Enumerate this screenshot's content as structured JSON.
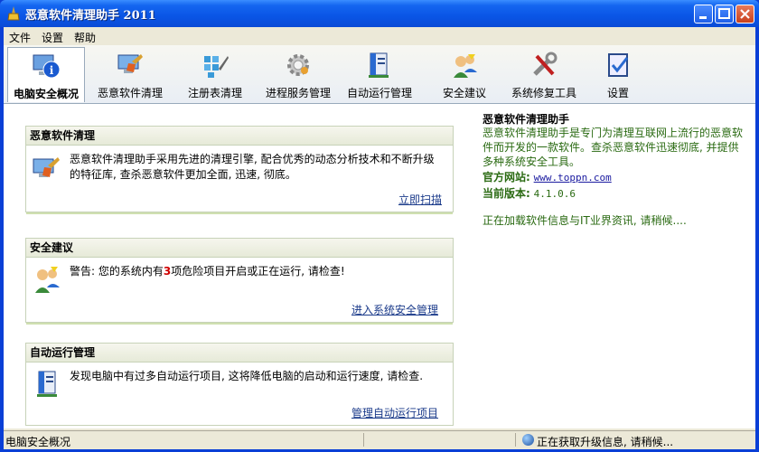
{
  "window": {
    "title": "恶意软件清理助手 2011"
  },
  "menu": [
    "文件",
    "设置",
    "帮助"
  ],
  "tabs": [
    {
      "label": "电脑安全概况",
      "icon": "info-icon",
      "active": true
    },
    {
      "label": "恶意软件清理",
      "icon": "cleaner-icon"
    },
    {
      "label": "注册表清理",
      "icon": "registry-icon"
    },
    {
      "label": "进程服务管理",
      "icon": "gear-icon"
    },
    {
      "label": "自动运行管理",
      "icon": "autorun-icon"
    },
    {
      "label": "安全建议",
      "icon": "users-icon"
    },
    {
      "label": "系统修复工具",
      "icon": "tools-icon"
    },
    {
      "label": "设置",
      "icon": "settings-check-icon"
    }
  ],
  "panels": {
    "malware": {
      "title": "恶意软件清理",
      "text": "恶意软件清理助手采用先进的清理引擎, 配合优秀的动态分析技术和不断升级的特征库, 查杀恶意软件更加全面, 迅速, 彻底。",
      "link": "立即扫描"
    },
    "security": {
      "title": "安全建议",
      "text_prefix": "警告: 您的系统内有",
      "count": "3",
      "text_suffix": "项危险项目开启或正在运行, 请检查!",
      "link": "进入系统安全管理"
    },
    "autorun": {
      "title": "自动运行管理",
      "text": "发现电脑中有过多自动运行项目, 这将降低电脑的启动和运行速度, 请检查.",
      "link": "管理自动运行项目"
    }
  },
  "info": {
    "heading": "恶意软件清理助手",
    "desc": "恶意软件清理助手是专门为清理互联网上流行的恶意软件而开发的一款软件。查杀恶意软件迅速彻底, 并提供多种系统安全工具。",
    "site_label": "官方网站:",
    "site_url": "www.toppn.com",
    "version_label": "当前版本:",
    "version": "4.1.0.6",
    "loading": "正在加载软件信息与IT业界资讯, 请稍候...."
  },
  "status": {
    "left": "电脑安全概况",
    "right": "正在获取升级信息, 请稍候..."
  },
  "colors": {
    "titlebar": "#0a55e6",
    "link": "#1a3a8a",
    "info_green": "#2a6a12",
    "warning_red": "#d00000"
  }
}
